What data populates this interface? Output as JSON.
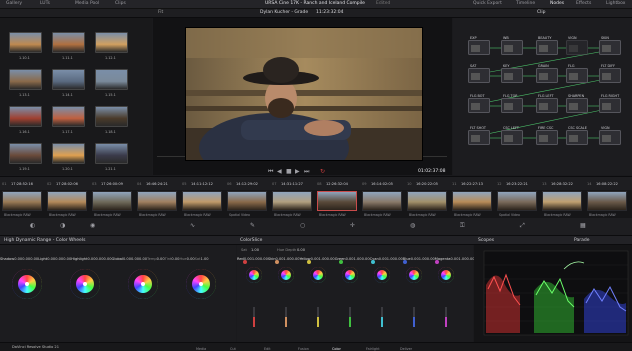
{
  "app": {
    "name": "DaVinci Resolve Studio 21",
    "project": "URSA Cine 17K - Ranch and Iceland Compile",
    "status": "Edited"
  },
  "topbar": {
    "items": [
      "Gallery",
      "LUTs",
      "Media Pool",
      "Clips"
    ],
    "right": [
      "Quick Export",
      "Timeline",
      "Nodes",
      "Effects",
      "Lightbox"
    ]
  },
  "viewer_bar": {
    "zoom": "Fit",
    "clip_name": "Dylan Kucher - Grade",
    "timecode": "11:23:32:04",
    "mode": "Clip"
  },
  "gallery": {
    "stills": [
      {
        "label": "1.10.1"
      },
      {
        "label": "1.11.1"
      },
      {
        "label": "1.12.1"
      },
      {
        "label": "1.13.1"
      },
      {
        "label": "1.14.1"
      },
      {
        "label": "1.15.1"
      },
      {
        "label": "1.16.1"
      },
      {
        "label": "1.17.1"
      },
      {
        "label": "1.18.1"
      },
      {
        "label": "1.19.1"
      },
      {
        "label": "1.20.1"
      },
      {
        "label": "1.21.1"
      }
    ]
  },
  "viewer": {
    "timecode": "01:02:37:08"
  },
  "nodes": {
    "items": [
      {
        "label": "EXP"
      },
      {
        "label": "WB"
      },
      {
        "label": "BEAUTY"
      },
      {
        "label": "VIGN"
      },
      {
        "label": "SKIN"
      },
      {
        "label": "SAT"
      },
      {
        "label": "KEY"
      },
      {
        "label": "GRAIN"
      },
      {
        "label": "FLG"
      },
      {
        "label": "FLT DIFF"
      },
      {
        "label": "FLG BOT"
      },
      {
        "label": "FLG TOP"
      },
      {
        "label": "FLG LEFT"
      },
      {
        "label": "SHARPEN"
      },
      {
        "label": "FLG RIGHT"
      },
      {
        "label": "FLT SHOT"
      },
      {
        "label": "CSC LEFT"
      },
      {
        "label": "FIRE CSC"
      },
      {
        "label": "CSC SCALE"
      },
      {
        "label": "VIGN"
      },
      {
        "label": "FILM LOOK"
      },
      {
        "label": "VIGN ROT"
      },
      {
        "label": "FX / SHP"
      },
      {
        "label": "NEG BUFF"
      }
    ]
  },
  "timeline": {
    "clips": [
      {
        "num": "01",
        "tc": "17:28:52:16",
        "name": "Blackmagic RAW"
      },
      {
        "num": "02",
        "tc": "17:28:02:06",
        "name": "Blackmagic RAW"
      },
      {
        "num": "03",
        "tc": "17:26:00:09",
        "name": "Blackmagic RAW"
      },
      {
        "num": "04",
        "tc": "16:46:24:21",
        "name": "Blackmagic RAW"
      },
      {
        "num": "05",
        "tc": "14:11:12:12",
        "name": "Blackmagic RAW"
      },
      {
        "num": "06",
        "tc": "14:12:29:02",
        "name": "Spatial Video"
      },
      {
        "num": "07",
        "tc": "14:31:11:27",
        "name": "Blackmagic RAW"
      },
      {
        "num": "08",
        "tc": "12:26:32:04",
        "name": "Blackmagic RAW"
      },
      {
        "num": "09",
        "tc": "16:14:02:05",
        "name": "Blackmagic RAW"
      },
      {
        "num": "10",
        "tc": "16:20:22:05",
        "name": "Blackmagic RAW"
      },
      {
        "num": "11",
        "tc": "16:22:27:13",
        "name": "Blackmagic RAW"
      },
      {
        "num": "12",
        "tc": "16:23:22:21",
        "name": "Spatial Video"
      },
      {
        "num": "13",
        "tc": "16:28:32:22",
        "name": "Blackmagic RAW"
      },
      {
        "num": "14",
        "tc": "16:08:22:22",
        "name": "Blackmagic RAW"
      }
    ]
  },
  "panels": {
    "wheels_title": "High Dynamic Range - Color Wheels",
    "colorslice_title": "ColorSlice",
    "scopes_title": "Scopes",
    "scopes_mode": "Parade",
    "wheels": [
      {
        "label": "Shadow",
        "x": "0.00",
        "y": "0.00",
        "z": "0.00"
      },
      {
        "label": "Light",
        "x": "0.00",
        "y": "0.00",
        "z": "0.00"
      },
      {
        "label": "Highlight",
        "x": "0.00",
        "y": "0.00",
        "z": "0.00"
      },
      {
        "label": "Global",
        "x": "0.00",
        "y": "0.00",
        "z": "0.00"
      }
    ],
    "wheel_footer": {
      "temp": "Temp",
      "tint": "Tint",
      "hue": "Hue",
      "sat": "Sat",
      "val": "0.00",
      "val2": "1.00"
    },
    "slices": [
      {
        "label": "Red",
        "color": "#d04040"
      },
      {
        "label": "Skin",
        "color": "#d09060"
      },
      {
        "label": "Yellow",
        "color": "#d0c040"
      },
      {
        "label": "Green",
        "color": "#40c040"
      },
      {
        "label": "Cyan",
        "color": "#40c0d0"
      },
      {
        "label": "Blue",
        "color": "#4060d0"
      },
      {
        "label": "Magenta",
        "color": "#c040c0"
      }
    ],
    "slice_top": {
      "sat": "Sat",
      "sat_val": "1.00",
      "hue": "Hue Depth",
      "hue_val": "0.00",
      "center": "Center",
      "zero": "0.00"
    },
    "slice_values": {
      "hue": "0.00",
      "sat": "1.00",
      "depth": "0.00"
    }
  },
  "pagebar": {
    "items": [
      "Media",
      "Cut",
      "Edit",
      "Fusion",
      "Color",
      "Fairlight",
      "Deliver"
    ]
  }
}
